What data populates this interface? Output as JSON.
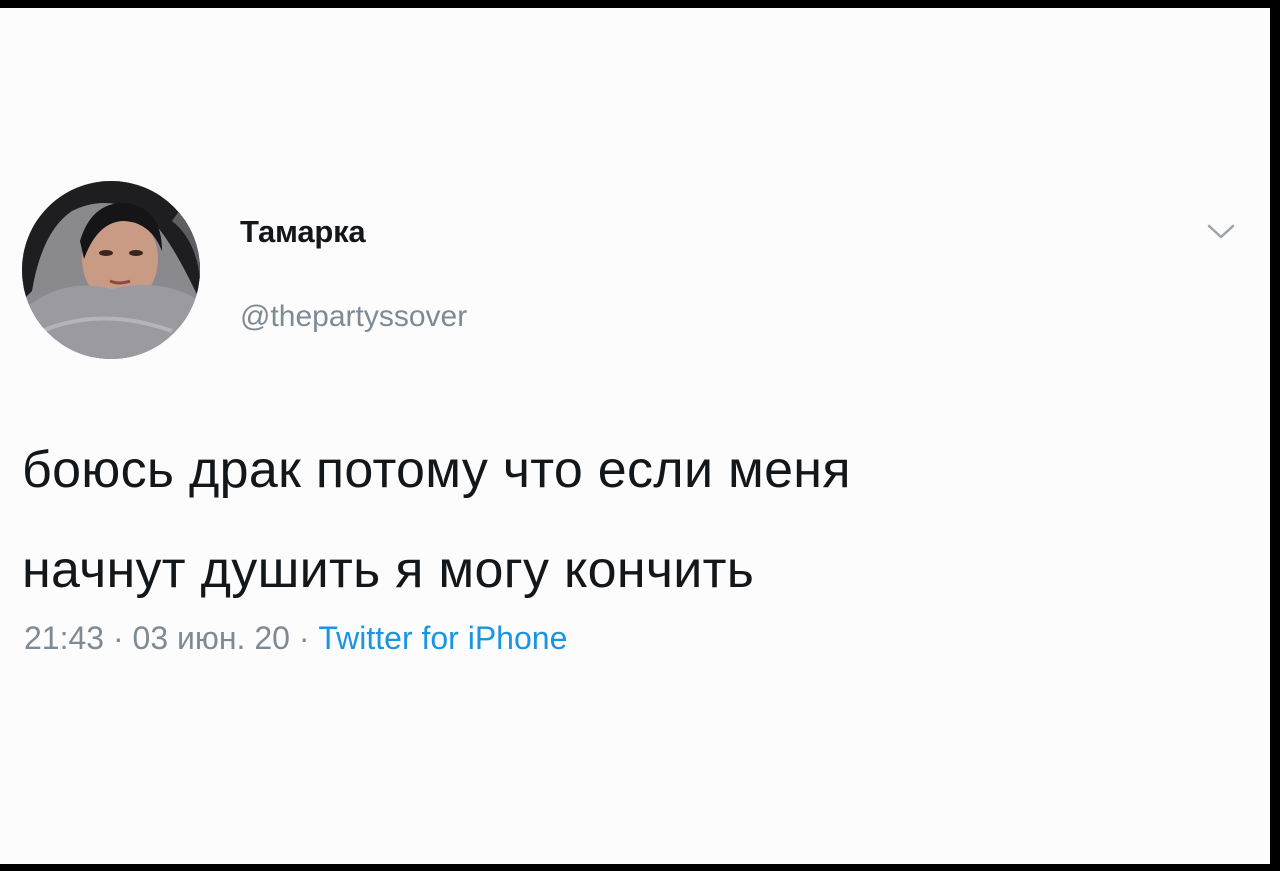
{
  "user": {
    "display_name": "Тамарка",
    "handle": "@thepartyssover",
    "avatar_icon": "avatar-photo"
  },
  "tweet": {
    "lines": [
      "боюсь драк потому что если меня",
      "начнут душить я могу кончить"
    ]
  },
  "meta": {
    "time": "21:43",
    "separator": " · ",
    "date": "03 июн. 20",
    "source": "Twitter for iPhone"
  },
  "menu": {
    "icon": "chevron-down-icon"
  },
  "colors": {
    "text": "#14171a",
    "secondary": "#7e8a94",
    "link": "#1b95e0",
    "background": "#fcfcfc",
    "border": "#000000"
  }
}
